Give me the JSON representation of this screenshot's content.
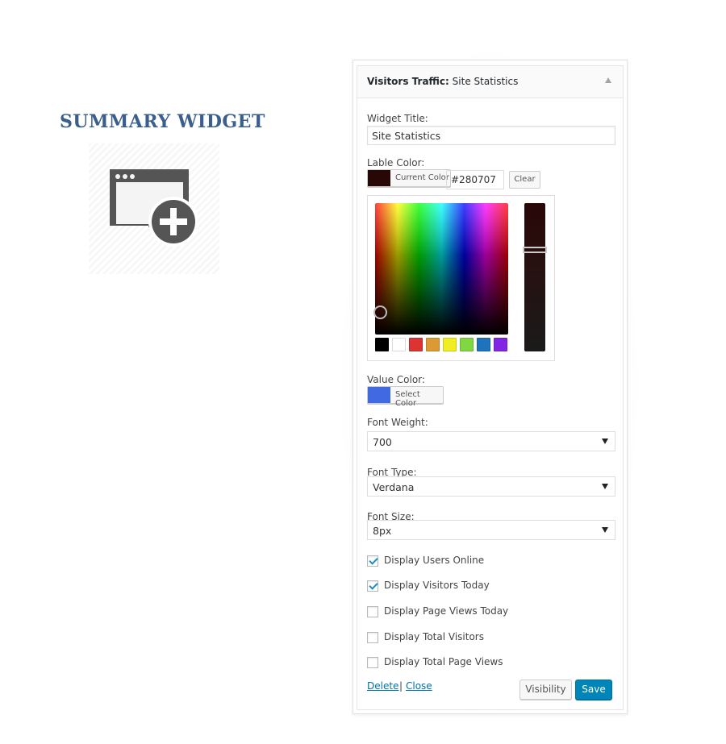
{
  "promo": {
    "title": "SUMMARY WIDGET",
    "icon": "add-window-icon"
  },
  "widget": {
    "header": {
      "title_strong": "Visitors Traffic:",
      "title_rest": " Site Statistics",
      "toggle_icon": "collapse-arrow-icon"
    },
    "widget_title": {
      "label": "Widget Title:",
      "value": "Site Statistics"
    },
    "label_color": {
      "label": "Lable Color:",
      "button_text": "Current Color",
      "swatch": "#280707",
      "hex_value": "#280707",
      "clear_label": "Clear"
    },
    "picker": {
      "palette": [
        "#000000",
        "#ffffff",
        "#dd3333",
        "#dd9933",
        "#eeee22",
        "#81d742",
        "#1e73be",
        "#8224e3"
      ]
    },
    "value_color": {
      "label": "Value Color:",
      "button_text": "Select Color",
      "swatch": "#4169e1"
    },
    "font_weight": {
      "label": "Font Weight:",
      "value": "700"
    },
    "font_type": {
      "label": "Font Type:",
      "value": "Verdana"
    },
    "font_size": {
      "label": "Font Size:",
      "value": "8px"
    },
    "checkboxes": [
      {
        "label": "Display Users Online",
        "checked": true
      },
      {
        "label": "Display Visitors Today",
        "checked": true
      },
      {
        "label": "Display Page Views Today",
        "checked": false
      },
      {
        "label": "Display Total Visitors",
        "checked": false
      },
      {
        "label": "Display Total Page Views",
        "checked": false
      }
    ],
    "footer": {
      "delete_label": "Delete",
      "separator": "|",
      "close_label": "Close",
      "visibility_label": "Visibility",
      "save_label": "Save"
    }
  }
}
